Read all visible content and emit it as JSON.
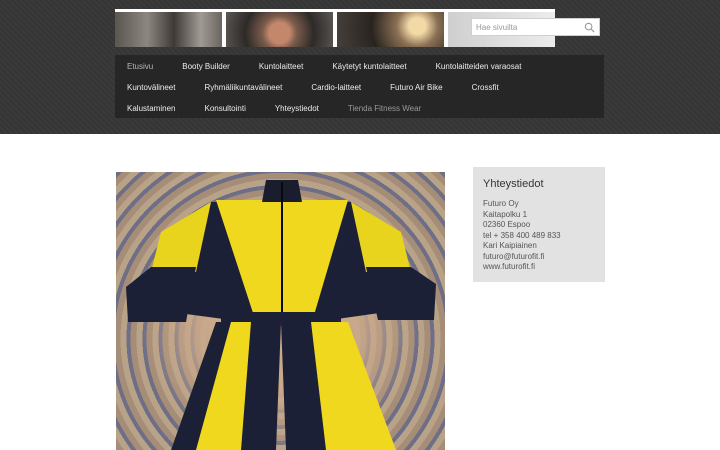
{
  "search": {
    "placeholder": "Hae sivuilta"
  },
  "nav": {
    "items": [
      "Etusivu",
      "Booty Builder",
      "Kuntolaitteet",
      "Käytetyt kuntolaitteet",
      "Kuntolaitteiden varaosat",
      "Kuntovälineet",
      "Ryhmäliikuntavälineet",
      "Cardio-laitteet",
      "Futuro Air Bike",
      "Crossfit",
      "Kalustaminen",
      "Konsultointi",
      "Yhteystiedot",
      "Tienda Fitness Wear"
    ]
  },
  "sidebar": {
    "title": "Yhteystiedot",
    "lines": [
      "Futuro Oy",
      "Kaitapolku 1",
      "02360 Espoo",
      "tel + 358 400 489 833",
      "Kari Kaipiainen",
      "futuro@futurofit.fi",
      "www.futurofit.fi"
    ]
  },
  "colors": {
    "header_bg": "#363636",
    "nav_bg": "#262626",
    "sidebar_bg": "#e2e2e2",
    "jacket_yellow": "#f0d81e",
    "jacket_navy": "#1b2036"
  },
  "icons": {
    "search": "search-icon"
  }
}
